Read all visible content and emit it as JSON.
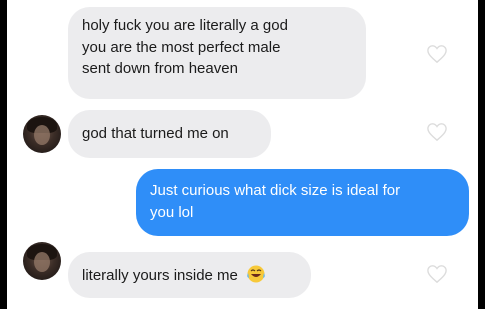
{
  "messages": [
    {
      "id": "m1",
      "direction": "received",
      "lines": [
        "holy fuck you are literally a god",
        "you are the most perfect male",
        "sent down from heaven"
      ],
      "show_avatar": false
    },
    {
      "id": "m2",
      "direction": "received",
      "lines": [
        "god that turned me on"
      ],
      "show_avatar": true
    },
    {
      "id": "m3",
      "direction": "sent",
      "lines": [
        "Just curious what dick size is ideal for",
        "you lol"
      ],
      "show_avatar": false
    },
    {
      "id": "m4",
      "direction": "received",
      "lines": [
        "literally yours inside me"
      ],
      "emoji": "laughing-tears-emoji",
      "show_avatar": true
    }
  ],
  "colors": {
    "received_bubble": "#ececee",
    "sent_bubble": "#2f8ef8",
    "heart_outline": "#dcdcdc",
    "background": "#ffffff"
  },
  "icons": {
    "like": "heart-outline-icon"
  }
}
